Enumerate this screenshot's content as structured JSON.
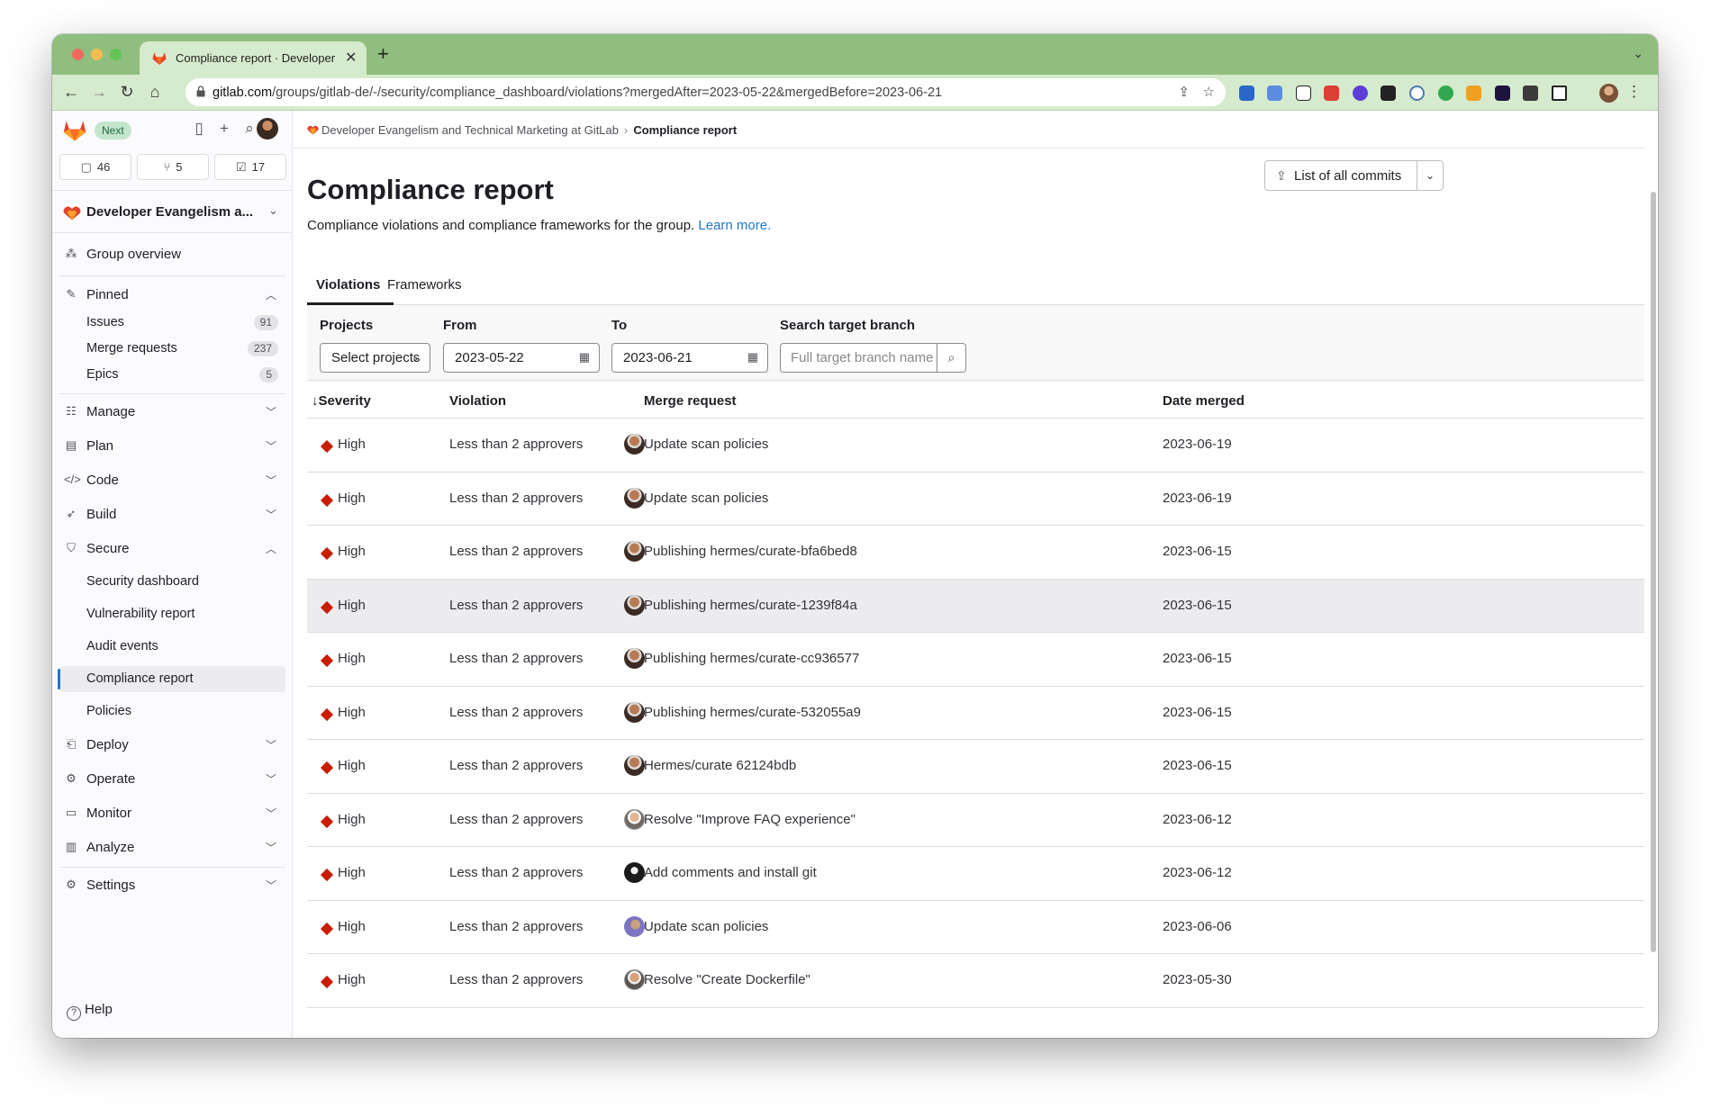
{
  "browser": {
    "tab_title": "Compliance report · Developer",
    "url_host": "gitlab.com",
    "url_path": "/groups/gitlab-de/-/security/compliance_dashboard/violations?mergedAfter=2023-05-22&mergedBefore=2023-06-21"
  },
  "sidebar": {
    "next_badge": "Next",
    "counters": {
      "issues": "46",
      "merge_requests": "5",
      "todos": "17"
    },
    "context_name": "Developer Evangelism a...",
    "group_overview": "Group overview",
    "pinned": "Pinned",
    "pinned_items": [
      {
        "label": "Issues",
        "count": "91"
      },
      {
        "label": "Merge requests",
        "count": "237"
      },
      {
        "label": "Epics",
        "count": "5"
      }
    ],
    "sections_top": [
      "Manage",
      "Plan",
      "Code",
      "Build"
    ],
    "secure": "Secure",
    "secure_items": [
      "Security dashboard",
      "Vulnerability report",
      "Audit events",
      "Compliance report",
      "Policies"
    ],
    "sections_bottom": [
      "Deploy",
      "Operate",
      "Monitor",
      "Analyze"
    ],
    "settings": "Settings",
    "help": "Help"
  },
  "page": {
    "breadcrumb_group": "Developer Evangelism and Technical Marketing at GitLab",
    "breadcrumb_current": "Compliance report",
    "title": "Compliance report",
    "description": "Compliance violations and compliance frameworks for the group.",
    "learn_more": "Learn more.",
    "commits_button": "List of all commits",
    "tabs": [
      "Violations",
      "Frameworks"
    ]
  },
  "filters": {
    "projects_label": "Projects",
    "projects_value": "Select projects",
    "from_label": "From",
    "from_value": "2023-05-22",
    "to_label": "To",
    "to_value": "2023-06-21",
    "branch_label": "Search target branch",
    "branch_placeholder": "Full target branch name"
  },
  "table": {
    "headers": [
      "↓Severity",
      "Violation",
      "Merge request",
      "Date merged"
    ],
    "rows": [
      {
        "severity": "High",
        "violation": "Less than 2 approvers",
        "merge_request": "Update scan policies",
        "date": "2023-06-19"
      },
      {
        "severity": "High",
        "violation": "Less than 2 approvers",
        "merge_request": "Update scan policies",
        "date": "2023-06-19"
      },
      {
        "severity": "High",
        "violation": "Less than 2 approvers",
        "merge_request": "Publishing hermes/curate-bfa6bed8",
        "date": "2023-06-15"
      },
      {
        "severity": "High",
        "violation": "Less than 2 approvers",
        "merge_request": "Publishing hermes/curate-1239f84a",
        "date": "2023-06-15"
      },
      {
        "severity": "High",
        "violation": "Less than 2 approvers",
        "merge_request": "Publishing hermes/curate-cc936577",
        "date": "2023-06-15"
      },
      {
        "severity": "High",
        "violation": "Less than 2 approvers",
        "merge_request": "Publishing hermes/curate-532055a9",
        "date": "2023-06-15"
      },
      {
        "severity": "High",
        "violation": "Less than 2 approvers",
        "merge_request": "Hermes/curate 62124bdb",
        "date": "2023-06-15"
      },
      {
        "severity": "High",
        "violation": "Less than 2 approvers",
        "merge_request": "Resolve \"Improve FAQ experience\"",
        "date": "2023-06-12"
      },
      {
        "severity": "High",
        "violation": "Less than 2 approvers",
        "merge_request": "Add comments and install git",
        "date": "2023-06-12"
      },
      {
        "severity": "High",
        "violation": "Less than 2 approvers",
        "merge_request": "Update scan policies",
        "date": "2023-06-06"
      },
      {
        "severity": "High",
        "violation": "Less than 2 approvers",
        "merge_request": "Resolve \"Create Dockerfile\"",
        "date": "2023-05-30"
      }
    ]
  },
  "colors": {
    "severity_high": "#c91c00",
    "link": "#1f75cb",
    "chrome": "#8fbe7e"
  }
}
